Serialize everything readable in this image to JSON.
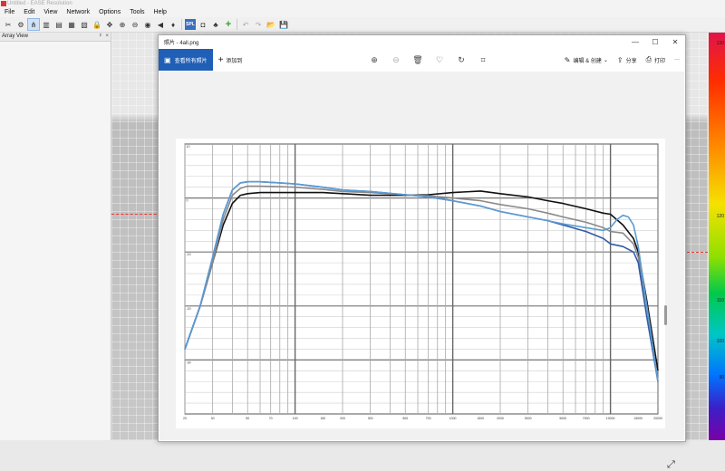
{
  "app": {
    "title": "Untitled - EASE Resolution",
    "menus": [
      "File",
      "Edit",
      "View",
      "Network",
      "Options",
      "Tools",
      "Help"
    ]
  },
  "left_panel": {
    "title": "Array View",
    "pin_label": "ᵖ",
    "close_label": "×"
  },
  "colorbar": {
    "labels": [
      {
        "text": "130",
        "pos": 0.02
      },
      {
        "text": "120",
        "pos": 0.445
      },
      {
        "text": "110",
        "pos": 0.65
      },
      {
        "text": "100",
        "pos": 0.75
      },
      {
        "text": "90",
        "pos": 0.84
      }
    ]
  },
  "photo_viewer": {
    "title": "照片 - 4all.png",
    "window_controls": [
      "—",
      "☐",
      "✕"
    ],
    "primary_button": "查看所有照片",
    "add_button": "添加到",
    "right_items": [
      "编辑 & 创建",
      "分享",
      "打印"
    ],
    "more": "···"
  },
  "chart_data": {
    "type": "line",
    "x_scale": "log",
    "xlim": [
      20,
      20000
    ],
    "ylim": [
      -40,
      10
    ],
    "x_tick_labels": [
      {
        "v": 20,
        "t": "20"
      },
      {
        "v": 30,
        "t": "30"
      },
      {
        "v": 50,
        "t": "50"
      },
      {
        "v": 70,
        "t": "70"
      },
      {
        "v": 100,
        "t": "100"
      },
      {
        "v": 150,
        "t": "150"
      },
      {
        "v": 200,
        "t": "200"
      },
      {
        "v": 300,
        "t": "300"
      },
      {
        "v": 500,
        "t": "500"
      },
      {
        "v": 700,
        "t": "700"
      },
      {
        "v": 1000,
        "t": "1000"
      },
      {
        "v": 1500,
        "t": "1500"
      },
      {
        "v": 2000,
        "t": "2000"
      },
      {
        "v": 3000,
        "t": "3000"
      },
      {
        "v": 5000,
        "t": "5000"
      },
      {
        "v": 7000,
        "t": "7000"
      },
      {
        "v": 10000,
        "t": "10000"
      },
      {
        "v": 15000,
        "t": "15000"
      },
      {
        "v": 20000,
        "t": "20000"
      }
    ],
    "y_tick_labels": [
      {
        "v": 10,
        "t": "10"
      },
      {
        "v": 0,
        "t": "0"
      },
      {
        "v": -10,
        "t": "-10"
      },
      {
        "v": -20,
        "t": "-20"
      },
      {
        "v": -30,
        "t": "-30"
      }
    ],
    "grid": true,
    "series": [
      {
        "color": "#111111",
        "x": [
          20,
          25,
          30,
          35,
          40,
          45,
          50,
          60,
          80,
          100,
          150,
          200,
          300,
          500,
          700,
          1000,
          1500,
          2000,
          3000,
          4000,
          5000,
          7000,
          9000,
          10000,
          12000,
          14000,
          15000,
          17000,
          20000
        ],
        "y": [
          -28,
          -20,
          -12,
          -5,
          -1,
          0.5,
          0.8,
          1,
          1,
          1,
          1,
          0.8,
          0.5,
          0.5,
          0.6,
          1,
          1.3,
          0.8,
          0.2,
          -0.5,
          -1,
          -2,
          -2.8,
          -3,
          -5,
          -7.5,
          -10,
          -19,
          -32
        ]
      },
      {
        "color": "#8a8a8a",
        "x": [
          20,
          25,
          30,
          35,
          40,
          45,
          50,
          60,
          80,
          100,
          150,
          200,
          300,
          500,
          700,
          1000,
          1500,
          2000,
          3000,
          4000,
          5000,
          7000,
          9000,
          10000,
          12000,
          14000,
          15000,
          17000,
          20000
        ],
        "y": [
          -28,
          -20,
          -12,
          -4,
          0.5,
          1.8,
          2.2,
          2.2,
          2.1,
          2,
          1.6,
          1.2,
          1,
          0.6,
          0.4,
          0,
          -0.5,
          -1.2,
          -2,
          -2.8,
          -3.5,
          -4.5,
          -5.5,
          -6.2,
          -6.5,
          -8.5,
          -11,
          -20,
          -34
        ]
      },
      {
        "color": "#2f5ba8",
        "x": [
          20,
          25,
          30,
          35,
          40,
          45,
          50,
          60,
          80,
          100,
          150,
          200,
          300,
          500,
          700,
          1000,
          1500,
          2000,
          3000,
          4000,
          5000,
          7000,
          9000,
          10000,
          12000,
          14000,
          15000,
          17000,
          20000
        ],
        "y": [
          -28,
          -20,
          -11,
          -3,
          1.5,
          2.8,
          3,
          3,
          2.8,
          2.6,
          2,
          1.5,
          1.2,
          0.6,
          0.2,
          -0.5,
          -1.5,
          -2.5,
          -3.5,
          -4.2,
          -5,
          -6.2,
          -7.5,
          -8.5,
          -9,
          -10,
          -12,
          -22,
          -34
        ]
      },
      {
        "color": "#5b9bd5",
        "x": [
          20,
          25,
          30,
          35,
          40,
          45,
          50,
          60,
          80,
          100,
          150,
          200,
          300,
          500,
          700,
          1000,
          1500,
          2000,
          3000,
          4000,
          5000,
          7000,
          9000,
          10000,
          11000,
          12000,
          13000,
          14000,
          15000,
          17000,
          20000
        ],
        "y": [
          -28,
          -20,
          -11,
          -3,
          1.5,
          2.8,
          3,
          3,
          2.8,
          2.6,
          2,
          1.5,
          1.2,
          0.6,
          0.2,
          -0.5,
          -1.5,
          -2.5,
          -3.5,
          -4.2,
          -4.8,
          -5.5,
          -6,
          -5.5,
          -4,
          -3.2,
          -3.5,
          -5,
          -9,
          -20,
          -34
        ]
      }
    ]
  }
}
